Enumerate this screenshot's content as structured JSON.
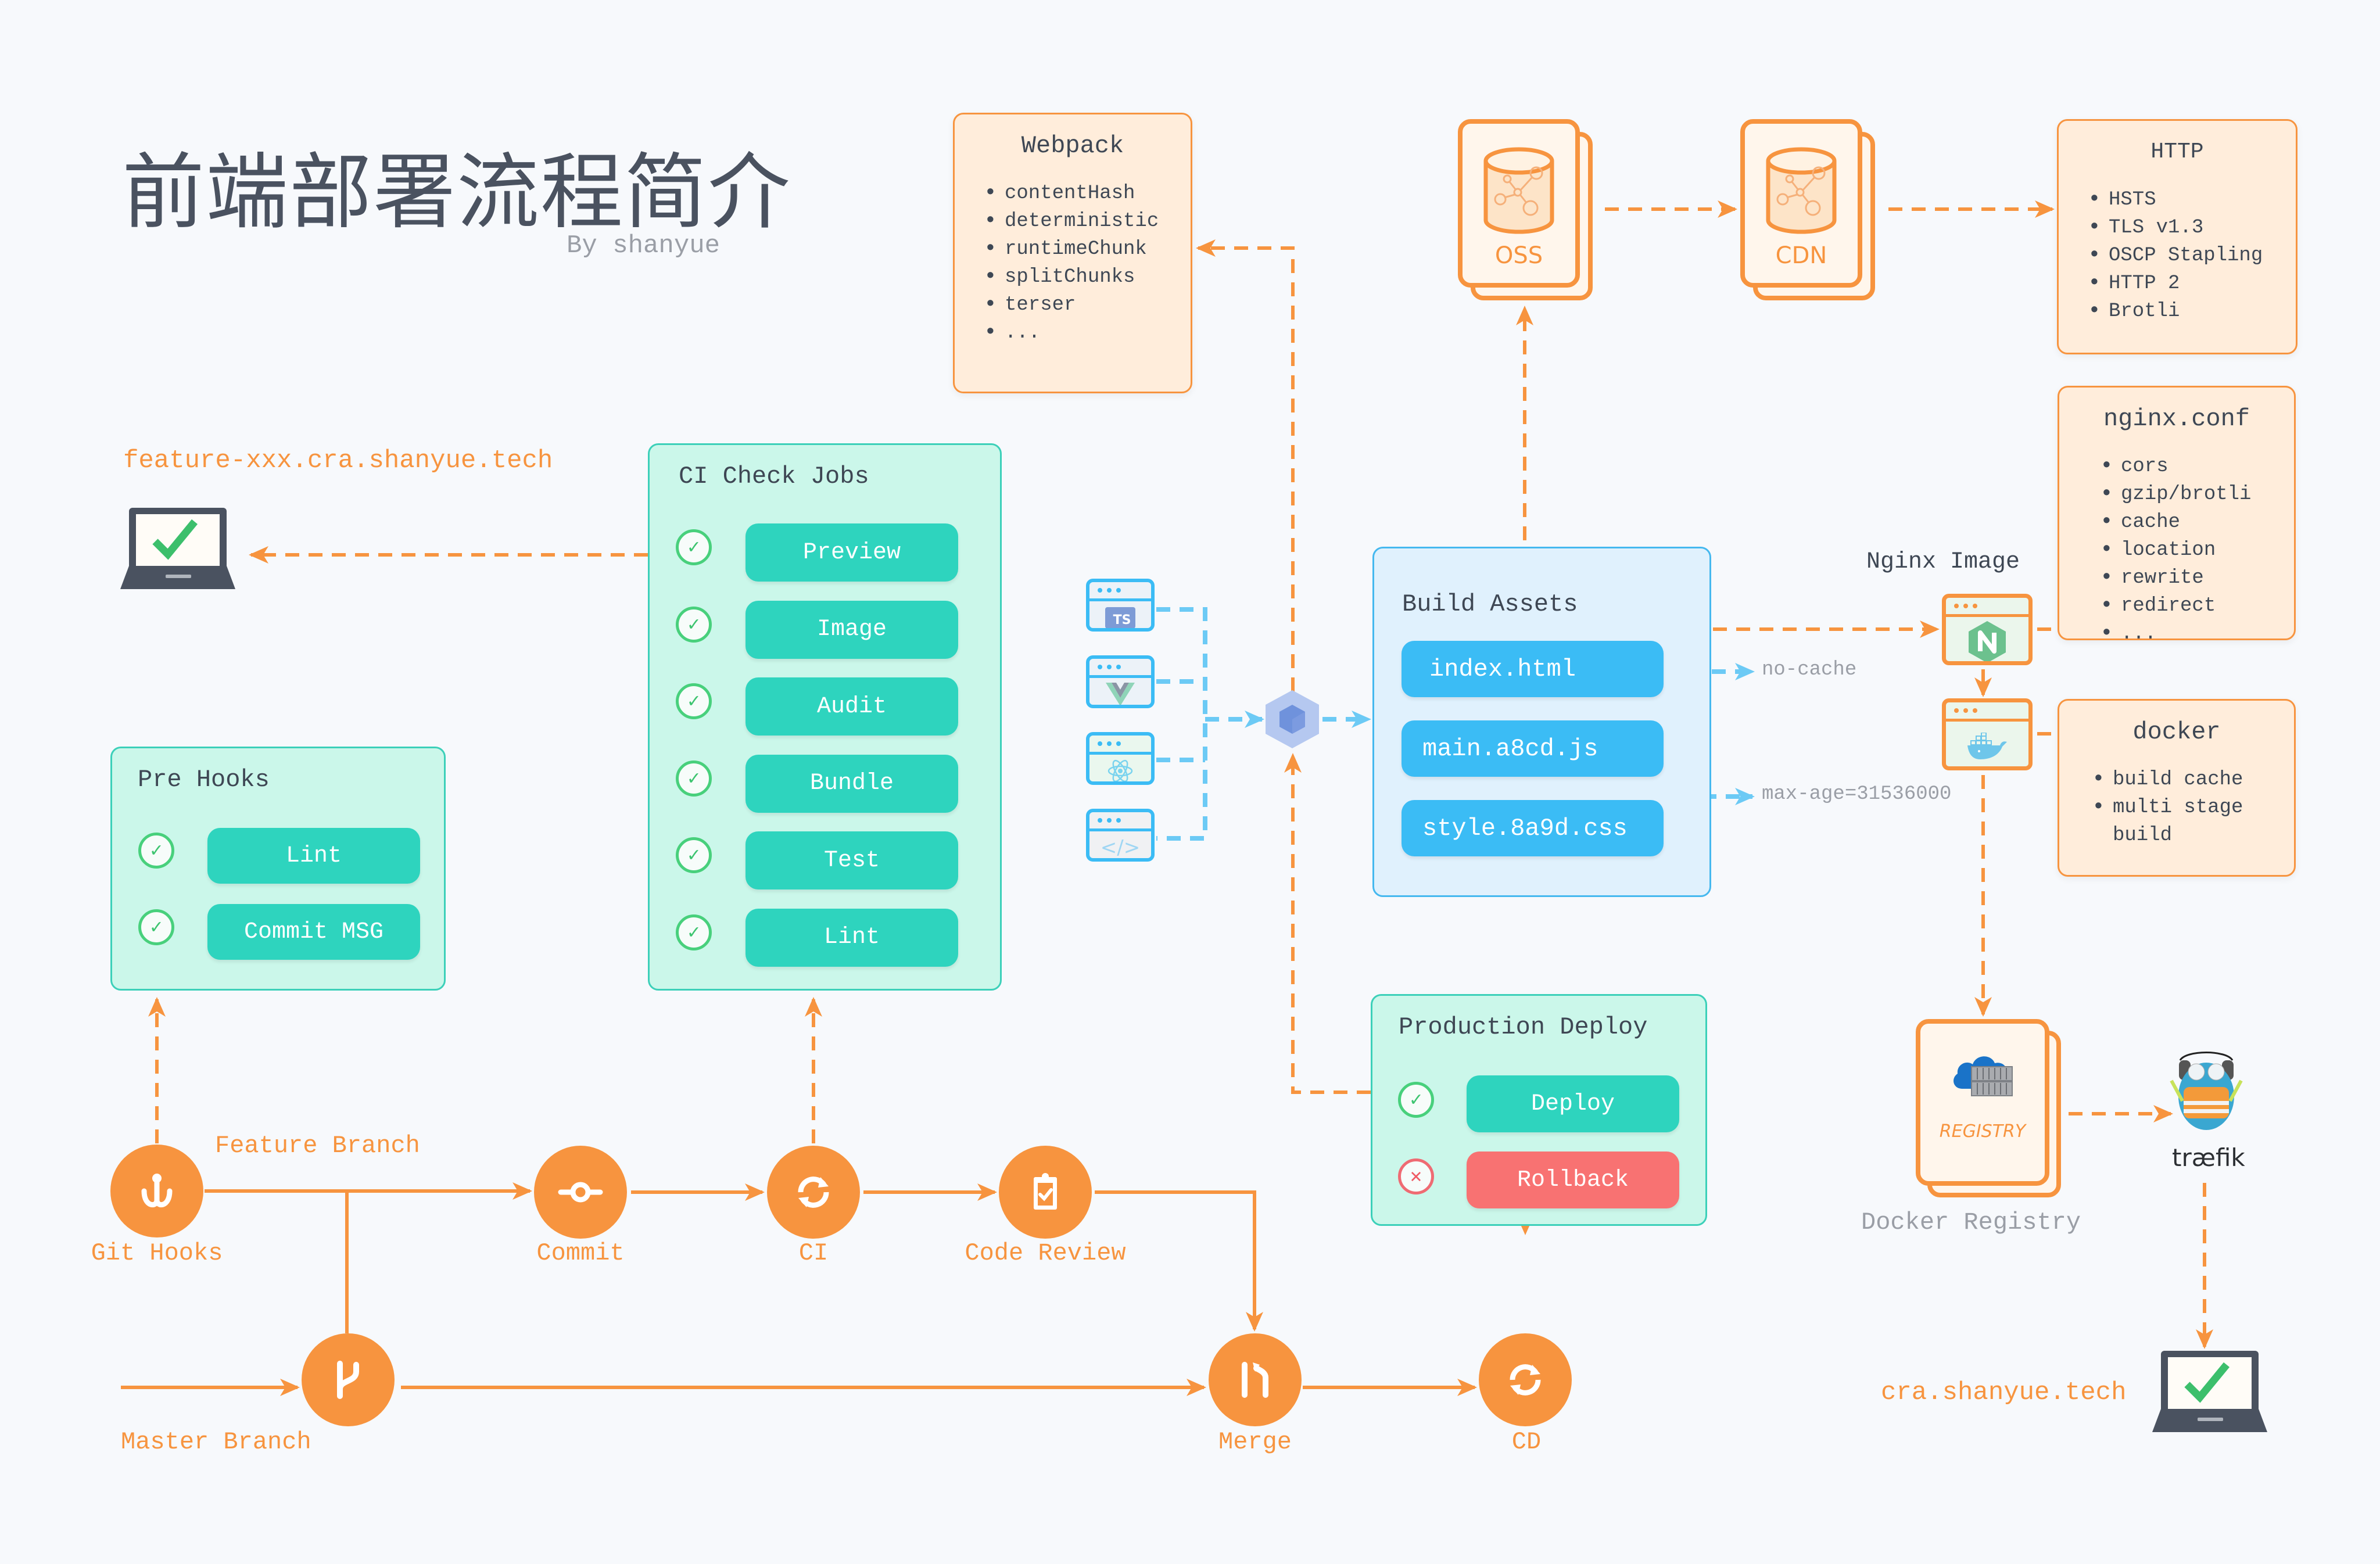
{
  "header": {
    "title": "前端部署流程简介",
    "byline": "By shanyue"
  },
  "colors": {
    "accent_orange": "#F7943F",
    "teal_button": "#2ED4BE",
    "teal_panel": "#CBF7EA",
    "blue_asset": "#3BBCF5",
    "rollback_red": "#F87272",
    "check_green": "#48D07C"
  },
  "preview": {
    "url": "feature-xxx.cra.shanyue.tech",
    "icon": "laptop-check-icon"
  },
  "pre_hooks": {
    "title": "Pre Hooks",
    "jobs": [
      {
        "label": "Lint",
        "status": "passed"
      },
      {
        "label": "Commit MSG",
        "status": "passed"
      }
    ]
  },
  "ci_check_jobs": {
    "title": "CI Check Jobs",
    "jobs": [
      {
        "label": "Preview",
        "status": "passed"
      },
      {
        "label": "Image",
        "status": "passed"
      },
      {
        "label": "Audit",
        "status": "passed"
      },
      {
        "label": "Bundle",
        "status": "passed"
      },
      {
        "label": "Test",
        "status": "passed"
      },
      {
        "label": "Lint",
        "status": "passed"
      }
    ]
  },
  "webpack": {
    "title": "Webpack",
    "items": [
      "contentHash",
      "deterministic",
      "runtimeChunk",
      "splitChunks",
      "terser",
      "..."
    ]
  },
  "sources": [
    {
      "icon": "typescript-icon",
      "text": "TS"
    },
    {
      "icon": "vue-icon"
    },
    {
      "icon": "react-icon"
    },
    {
      "icon": "code-icon",
      "text": "</>"
    }
  ],
  "bundler": {
    "icon": "webpack-cube-icon"
  },
  "build_assets": {
    "title": "Build Assets",
    "files": [
      "index.html",
      "main.a8cd.js",
      "style.8a9d.css"
    ]
  },
  "cache_policies": {
    "html": "no-cache",
    "static": "max-age=31536000"
  },
  "storage": {
    "oss": "OSS",
    "cdn": "CDN"
  },
  "http": {
    "title": "HTTP",
    "items": [
      "HSTS",
      "TLS v1.3",
      "OSCP Stapling",
      "HTTP 2",
      "Brotli"
    ]
  },
  "nginx_image": {
    "label": "Nginx Image",
    "nginx_letter": "N"
  },
  "nginx_conf": {
    "title": "nginx.conf",
    "items": [
      "cors",
      "gzip/brotli",
      "cache",
      "location",
      "rewrite",
      "redirect",
      "..."
    ]
  },
  "docker": {
    "title": "docker",
    "items": [
      "build cache",
      "multi stage",
      "build"
    ]
  },
  "registry": {
    "box_label": "REGISTRY",
    "caption": "Docker Registry"
  },
  "traefik": {
    "label": "træfik"
  },
  "production": {
    "url": "cra.shanyue.tech"
  },
  "production_deploy": {
    "title": "Production Deploy",
    "actions": [
      {
        "label": "Deploy",
        "status": "passed"
      },
      {
        "label": "Rollback",
        "status": "failed"
      }
    ]
  },
  "flow": {
    "feature_branch_label": "Feature Branch",
    "master_branch_label": "Master Branch",
    "nodes": [
      {
        "id": "git-hooks",
        "label": "Git Hooks",
        "icon": "hook-icon"
      },
      {
        "id": "commit",
        "label": "Commit",
        "icon": "commit-icon"
      },
      {
        "id": "ci",
        "label": "CI",
        "icon": "sync-icon"
      },
      {
        "id": "code-review",
        "label": "Code Review",
        "icon": "clipboard-check-icon"
      },
      {
        "id": "branch",
        "label": "",
        "icon": "git-branch-icon"
      },
      {
        "id": "merge",
        "label": "Merge",
        "icon": "git-merge-icon"
      },
      {
        "id": "cd",
        "label": "CD",
        "icon": "sync-icon"
      }
    ]
  }
}
